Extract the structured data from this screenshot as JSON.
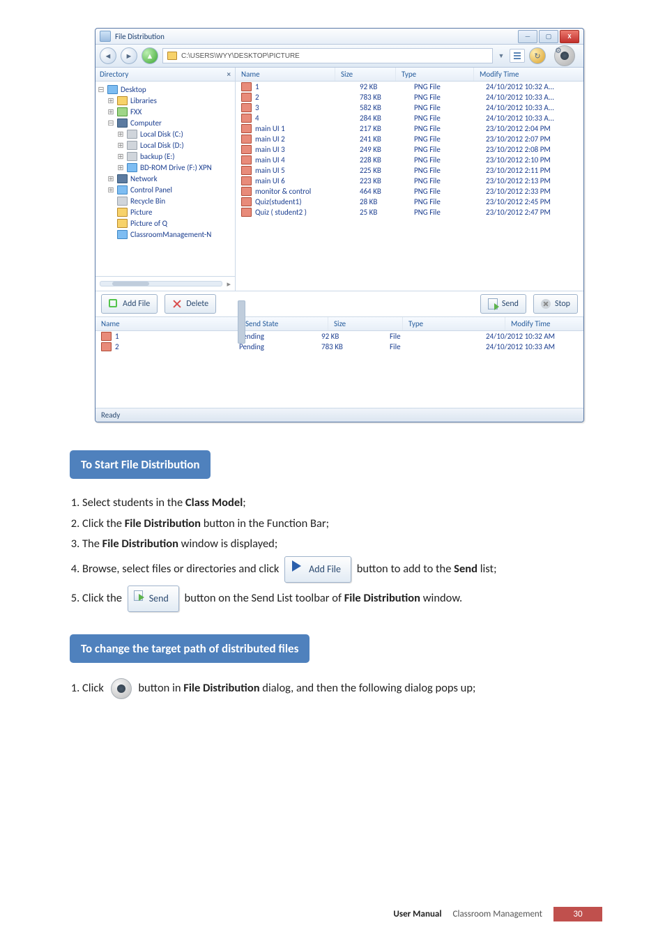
{
  "window": {
    "title": "File Distribution",
    "path": "C:\\USERS\\WYY\\DESKTOP\\PICTURE",
    "min": "—",
    "max": "▢",
    "close": "X",
    "dir_col": "Directory",
    "x": "×",
    "cols": {
      "name": "Name",
      "size": "Size",
      "type": "Type",
      "time": "Modify Time"
    },
    "tree": [
      {
        "pad": 0,
        "icon": "blue",
        "label": "Desktop",
        "pre": "⊟"
      },
      {
        "pad": 14,
        "icon": "",
        "label": "Libraries",
        "pre": "⊞"
      },
      {
        "pad": 14,
        "icon": "grn",
        "label": "FXX",
        "pre": "⊞"
      },
      {
        "pad": 14,
        "icon": "dk",
        "label": "Computer",
        "pre": "⊟"
      },
      {
        "pad": 28,
        "icon": "gray",
        "label": "Local Disk (C:)",
        "pre": "⊞"
      },
      {
        "pad": 28,
        "icon": "gray",
        "label": "Local Disk (D:)",
        "pre": "⊞"
      },
      {
        "pad": 28,
        "icon": "gray",
        "label": "backup (E:)",
        "pre": "⊞"
      },
      {
        "pad": 28,
        "icon": "blue",
        "label": "BD-ROM Drive (F:) XPN",
        "pre": "⊞"
      },
      {
        "pad": 14,
        "icon": "dk",
        "label": "Network",
        "pre": "⊞"
      },
      {
        "pad": 14,
        "icon": "blue",
        "label": "Control Panel",
        "pre": "⊞"
      },
      {
        "pad": 14,
        "icon": "gray",
        "label": "Recycle Bin",
        "pre": ""
      },
      {
        "pad": 14,
        "icon": "",
        "label": "Picture",
        "pre": ""
      },
      {
        "pad": 14,
        "icon": "",
        "label": "Picture of Q",
        "pre": ""
      },
      {
        "pad": 14,
        "icon": "blue",
        "label": "ClassroomManagement-N",
        "pre": ""
      }
    ],
    "files": [
      {
        "n": "1",
        "s": "92 KB",
        "t": "PNG File",
        "m": "24/10/2012 10:32 A..."
      },
      {
        "n": "2",
        "s": "783 KB",
        "t": "PNG File",
        "m": "24/10/2012 10:33 A..."
      },
      {
        "n": "3",
        "s": "582 KB",
        "t": "PNG File",
        "m": "24/10/2012 10:33 A..."
      },
      {
        "n": "4",
        "s": "284 KB",
        "t": "PNG File",
        "m": "24/10/2012 10:33 A..."
      },
      {
        "n": "main UI 1",
        "s": "217 KB",
        "t": "PNG File",
        "m": "23/10/2012 2:04 PM"
      },
      {
        "n": "main UI 2",
        "s": "241 KB",
        "t": "PNG File",
        "m": "23/10/2012 2:07 PM"
      },
      {
        "n": "main UI 3",
        "s": "249 KB",
        "t": "PNG File",
        "m": "23/10/2012 2:08 PM"
      },
      {
        "n": "main UI 4",
        "s": "228 KB",
        "t": "PNG File",
        "m": "23/10/2012 2:10 PM"
      },
      {
        "n": "main UI 5",
        "s": "225 KB",
        "t": "PNG File",
        "m": "23/10/2012 2:11 PM"
      },
      {
        "n": "main UI 6",
        "s": "223 KB",
        "t": "PNG File",
        "m": "23/10/2012 2:13 PM"
      },
      {
        "n": "monitor & control",
        "s": "464 KB",
        "t": "PNG File",
        "m": "23/10/2012 2:33 PM"
      },
      {
        "n": "Quiz(student1)",
        "s": "28 KB",
        "t": "PNG File",
        "m": "23/10/2012 2:45 PM"
      },
      {
        "n": "Quiz ( student2 )",
        "s": "25 KB",
        "t": "PNG File",
        "m": "23/10/2012 2:47 PM"
      }
    ],
    "btns": {
      "add": "Add File",
      "del": "Delete",
      "send": "Send",
      "stop": "Stop"
    },
    "send_cols": {
      "name": "Name",
      "state": "Send State",
      "size": "Size",
      "type": "Type",
      "mtime": "Modify Time"
    },
    "send_rows": [
      {
        "n": "1",
        "st": "Pending",
        "s": "92 KB",
        "t": "File",
        "m": "24/10/2012 10:32 AM"
      },
      {
        "n": "2",
        "st": "Pending",
        "s": "783 KB",
        "t": "File",
        "m": "24/10/2012 10:33 AM"
      }
    ],
    "status": "Ready"
  },
  "heading1": "To Start File Distribution",
  "steps1": {
    "s1a": "Select students in the ",
    "s1b": "Class Model",
    "s1c": ";",
    "s2a": "Click the ",
    "s2b": "File Distribution",
    "s2c": " button in the Function Bar;",
    "s3a": "The ",
    "s3b": "File Distribution",
    "s3c": " window is displayed;",
    "s4a": "Browse, select files or directories and click ",
    "s4btn": "Add File",
    "s4b": " button to add to the ",
    "s4c": "Send",
    "s4d": " list;",
    "s5a": "Click the ",
    "s5btn": "Send",
    "s5b": " button on the Send List toolbar of ",
    "s5c": "File Distribution",
    "s5d": " window."
  },
  "heading2": "To change the target path of distributed files",
  "steps2": {
    "s1a": "Click ",
    "s1b": " button in ",
    "s1c": "File Distribution",
    "s1d": " dialog, and then the following dialog pops up;"
  },
  "footer": {
    "um": "User Manual",
    "prod": "Classroom  Management",
    "page": "30"
  }
}
